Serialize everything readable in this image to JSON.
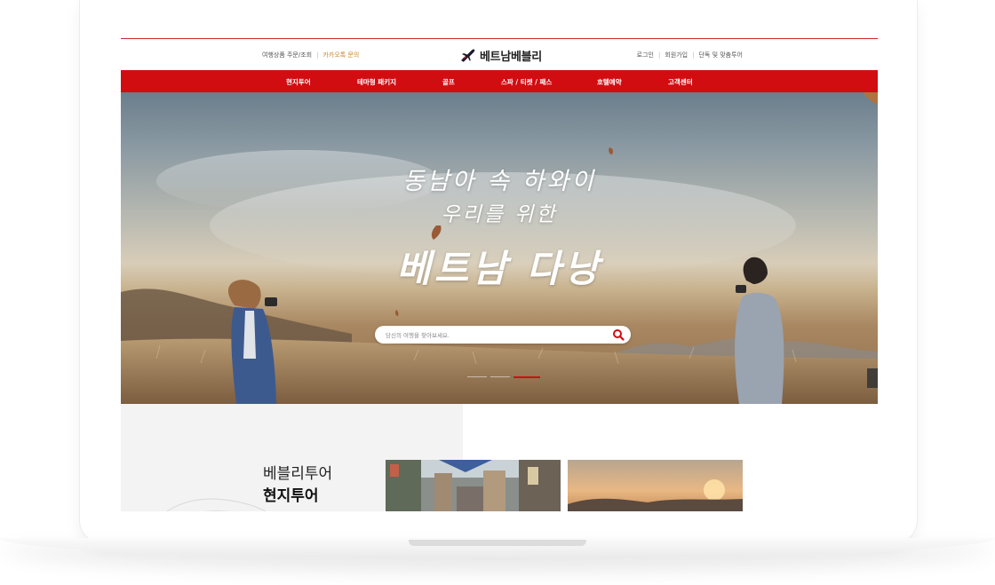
{
  "topbar": {
    "order_lookup": "여행상품 주문/조회",
    "kakao_inquiry": "카카오톡 문의",
    "logo_text": "베트남베블리",
    "login": "로그인",
    "signup": "회원가입",
    "custom_tour": "단독 및 맞춤투어"
  },
  "nav": {
    "items": [
      "현지투어",
      "테마형 패키지",
      "골프",
      "스파 / 티켓 / 패스",
      "호텔예약",
      "고객센터"
    ]
  },
  "hero": {
    "line1": "동남아 속 하와이",
    "line2": "우리를 위한",
    "line3": "베트남 다낭",
    "search_placeholder": "당신의 여행을 찾아보세요.",
    "slides_total": 3,
    "slide_active": 3
  },
  "section": {
    "subtitle": "베블리투어",
    "title": "현지투어"
  },
  "icons": {
    "logo": "airplane-icon",
    "search": "search-icon"
  },
  "colors": {
    "brand_red": "#d10d12",
    "kakao_accent": "#c9882c"
  }
}
